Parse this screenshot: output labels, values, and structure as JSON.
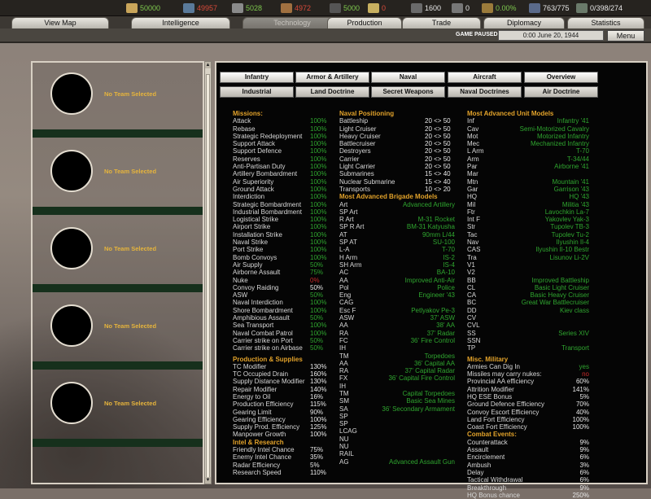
{
  "resources": [
    {
      "icon": "supplies-icon",
      "value": "50000",
      "color": "#7ec94e"
    },
    {
      "icon": "energy-icon",
      "value": "49957",
      "color": "#d94a3a"
    },
    {
      "icon": "metal-icon",
      "value": "5028",
      "color": "#7ec94e"
    },
    {
      "icon": "rare-materials-icon",
      "value": "4972",
      "color": "#d94a3a"
    },
    {
      "icon": "oil-icon",
      "value": "5000",
      "color": "#7ec94e"
    },
    {
      "icon": "money-icon",
      "value": "0",
      "color": "#d94a3a"
    },
    {
      "icon": "manpower-icon",
      "value": "1600",
      "color": "#e8e8e8"
    },
    {
      "icon": "nuke-icon",
      "value": "0",
      "color": "#e8e8e8"
    },
    {
      "icon": "dissent-icon",
      "value": "0.00%",
      "color": "#7ec94e"
    },
    {
      "icon": "transports-icon",
      "value": "763/775",
      "color": "#e8e8e8"
    },
    {
      "icon": "escorts-icon",
      "value": "0/398/274",
      "color": "#e8e8e8"
    }
  ],
  "tabs": [
    "View Map",
    "Intelligence",
    "Technology",
    "Production",
    "Trade",
    "Diplomacy",
    "Statistics"
  ],
  "active_tab": "Technology",
  "status": {
    "paused": "GAME PAUSED",
    "date": "0:00 June 20, 1944",
    "menu": "Menu"
  },
  "teams": [
    "No Team Selected",
    "No Team Selected",
    "No Team Selected",
    "No Team Selected",
    "No Team Selected"
  ],
  "tech_tabs_row1": [
    "Infantry",
    "Armor & Artillery",
    "Naval",
    "Aircraft",
    "Overview"
  ],
  "tech_tabs_row2": [
    "Industrial",
    "Land Doctrine",
    "Secret Weapons",
    "Naval Doctrines",
    "Air Doctrine"
  ],
  "col1": {
    "missions_title": "Missions:",
    "missions": [
      [
        "Attack",
        "100%",
        "g"
      ],
      [
        "Rebase",
        "100%",
        "g"
      ],
      [
        "Strategic Redeployment",
        "100%",
        "g"
      ],
      [
        "Support Attack",
        "100%",
        "g"
      ],
      [
        "Support Defence",
        "100%",
        "g"
      ],
      [
        "Reserves",
        "100%",
        "g"
      ],
      [
        "Anti-Partisan Duty",
        "100%",
        "g"
      ],
      [
        "Artillery Bombardment",
        "100%",
        "g"
      ],
      [
        "Air Superiority",
        "100%",
        "g"
      ],
      [
        "Ground Attack",
        "100%",
        "g"
      ],
      [
        "Interdiction",
        "100%",
        "g"
      ],
      [
        "Strategic Bombardment",
        "100%",
        "g"
      ],
      [
        "Industrial Bombardment",
        "100%",
        "g"
      ],
      [
        "Logistical Strike",
        "100%",
        "g"
      ],
      [
        "Airport Strike",
        "100%",
        "g"
      ],
      [
        "Installation Strike",
        "100%",
        "g"
      ],
      [
        "Naval Strike",
        "100%",
        "g"
      ],
      [
        "Port Strike",
        "100%",
        "g"
      ],
      [
        "Bomb Convoys",
        "100%",
        "g"
      ],
      [
        "Air Supply",
        "50%",
        "g"
      ],
      [
        "Airborne Assault",
        "75%",
        "g"
      ],
      [
        "Nuke",
        "0%",
        "r"
      ],
      [
        "Convoy Raiding",
        "50%",
        "w"
      ],
      [
        "ASW",
        "50%",
        "g"
      ],
      [
        "Naval Interdiction",
        "100%",
        "g"
      ],
      [
        "Shore Bombardment",
        "100%",
        "g"
      ],
      [
        "Amphibious Assault",
        "50%",
        "g"
      ],
      [
        "Sea Transport",
        "100%",
        "g"
      ],
      [
        "Naval Combat Patrol",
        "100%",
        "g"
      ],
      [
        "Carrier strike on Port",
        "50%",
        "g"
      ],
      [
        "Carrier strike on Airbase",
        "50%",
        "g"
      ]
    ],
    "production_title": "Production & Supplies",
    "production": [
      [
        "TC Modifier",
        "130%"
      ],
      [
        "TC Occupied Drain",
        "160%"
      ],
      [
        "Supply Distance Modifier",
        "130%"
      ],
      [
        "Repair Modifier",
        "140%"
      ],
      [
        "Energy to Oil",
        "16%"
      ],
      [
        "Production Efficiency",
        "115%"
      ],
      [
        "Gearing Limit",
        "90%"
      ],
      [
        "Gearing Efficiency",
        "100%"
      ],
      [
        "Supply Prod. Efficiency",
        "125%"
      ],
      [
        "Manpower Growth",
        "100%"
      ]
    ],
    "intel_title": "Intel & Research",
    "intel": [
      [
        "Friendly Intel Chance",
        "75%"
      ],
      [
        "Enemy Intel Chance",
        "35%"
      ],
      [
        "Radar Efficiency",
        "5%"
      ],
      [
        "Research Speed",
        "110%"
      ]
    ]
  },
  "col2": {
    "naval_title": "Naval Positioning",
    "naval": [
      [
        "Battleship",
        "20 <> 50"
      ],
      [
        "Light Cruiser",
        "20 <> 50"
      ],
      [
        "Heavy Cruiser",
        "20 <> 50"
      ],
      [
        "Battlecruiser",
        "20 <> 50"
      ],
      [
        "Destroyers",
        "20 <> 50"
      ],
      [
        "Carrier",
        "20 <> 50"
      ],
      [
        "Light Carrier",
        "20 <> 50"
      ],
      [
        "Submarines",
        "15 <> 40"
      ],
      [
        "Nuclear Submarine",
        "15 <> 40"
      ],
      [
        "Transports",
        "10 <> 20"
      ]
    ],
    "brigade_title": "Most Advanced Brigade Models",
    "brigades": [
      [
        "Art",
        "Advanced Artillery"
      ],
      [
        "SP Art",
        ""
      ],
      [
        "R Art",
        "M-31 Rocket"
      ],
      [
        "SP R Art",
        "BM-31 Katyusha"
      ],
      [
        "AT",
        "90mm L/44"
      ],
      [
        "SP AT",
        "SU-100"
      ],
      [
        "L-A",
        "T-70"
      ],
      [
        "H Arm",
        "IS-2"
      ],
      [
        "SH Arm",
        "IS-4"
      ],
      [
        "AC",
        "BA-10"
      ],
      [
        "AA",
        "Improved Anti-Air"
      ],
      [
        "Pol",
        "Police"
      ],
      [
        "Eng",
        "Engineer '43"
      ],
      [
        "CAG",
        ""
      ],
      [
        "Esc F",
        "Petlyakov Pe-3"
      ],
      [
        "ASW",
        "37' ASW"
      ],
      [
        "AA",
        "38' AA"
      ],
      [
        "RA",
        "37' Radar"
      ],
      [
        "FC",
        "36' Fire Control"
      ],
      [
        "IH",
        ""
      ],
      [
        "TM",
        "Torpedoes"
      ],
      [
        "AA",
        "36' Capital AA"
      ],
      [
        "RA",
        "37' Capital Radar"
      ],
      [
        "FX",
        "36' Capital Fire Control"
      ],
      [
        "IH",
        ""
      ],
      [
        "TM",
        "Capital Torpedoes"
      ],
      [
        "SM",
        "Basic Sea Mines"
      ],
      [
        "SA",
        "36' Secondary Armament"
      ],
      [
        "SP",
        ""
      ],
      [
        "SP",
        ""
      ],
      [
        "LCAG",
        ""
      ],
      [
        "NU",
        ""
      ],
      [
        "NU",
        ""
      ],
      [
        "RAIL",
        ""
      ],
      [
        "AG",
        "Advanced Assault Gun"
      ]
    ]
  },
  "col3": {
    "units_title": "Most Advanced Unit Models",
    "units": [
      [
        "Inf",
        "Infantry '41"
      ],
      [
        "Cav",
        "Semi-Motorized Cavalry"
      ],
      [
        "Mot",
        "Motorized Infantry"
      ],
      [
        "Mec",
        "Mechanized Infantry"
      ],
      [
        "L Arm",
        "T-70"
      ],
      [
        "Arm",
        "T-34/44"
      ],
      [
        "Par",
        "Airborne '41"
      ],
      [
        "Mar",
        ""
      ],
      [
        "Mtn",
        "Mountain '41"
      ],
      [
        "Gar",
        "Garrison '43"
      ],
      [
        "HQ",
        "HQ '43"
      ],
      [
        "Mil",
        "Militia '43"
      ],
      [
        "Ftr",
        "Lavochkin La-7"
      ],
      [
        "Int F",
        "Yakovlev Yak-3"
      ],
      [
        "Str",
        "Tupolev TB-3"
      ],
      [
        "Tac",
        "Tupolev Tu-2"
      ],
      [
        "Nav",
        "Ilyushin Il-4"
      ],
      [
        "CAS",
        "Ilyushin Il-10 Bestr"
      ],
      [
        "Tra",
        "Lisunov Li-2V"
      ],
      [
        "V1",
        ""
      ],
      [
        "V2",
        ""
      ],
      [
        "BB",
        "Improved Battleship"
      ],
      [
        "CL",
        "Basic Light Cruiser"
      ],
      [
        "CA",
        "Basic Heavy Cruiser"
      ],
      [
        "BC",
        "Great War Battlecruiser"
      ],
      [
        "DD",
        "Kiev class"
      ],
      [
        "CV",
        ""
      ],
      [
        "CVL",
        ""
      ],
      [
        "SS",
        "Series XIV"
      ],
      [
        "SSN",
        ""
      ],
      [
        "TP",
        "Transport"
      ]
    ],
    "misc_title": "Misc. Military",
    "misc": [
      [
        "Armies Can Dig In",
        "yes",
        "g"
      ],
      [
        "Missiles may carry nukes:",
        "no",
        "r"
      ],
      [
        "Provincial AA efficiency",
        "60%",
        "w"
      ],
      [
        "Attrition Modifier",
        "141%",
        "w"
      ],
      [
        "HQ ESE Bonus",
        "5%",
        "w"
      ],
      [
        "Ground Defence Efficiency",
        "70%",
        "w"
      ],
      [
        "Convoy Escort Efficiency",
        "40%",
        "w"
      ],
      [
        "Land Fort Efficiency",
        "100%",
        "w"
      ],
      [
        "Coast Fort Efficiency",
        "100%",
        "w"
      ]
    ],
    "combat_title": "Combat Events:",
    "combat": [
      [
        "Counterattack",
        "9%"
      ],
      [
        "Assault",
        "9%"
      ],
      [
        "Encirclement",
        "6%"
      ],
      [
        "Ambush",
        "3%"
      ],
      [
        "Delay",
        "6%"
      ],
      [
        "Tactical Withdrawal",
        "6%"
      ],
      [
        "Breakthrough",
        "9%"
      ],
      [
        "HQ Bonus chance",
        "250%"
      ]
    ]
  }
}
